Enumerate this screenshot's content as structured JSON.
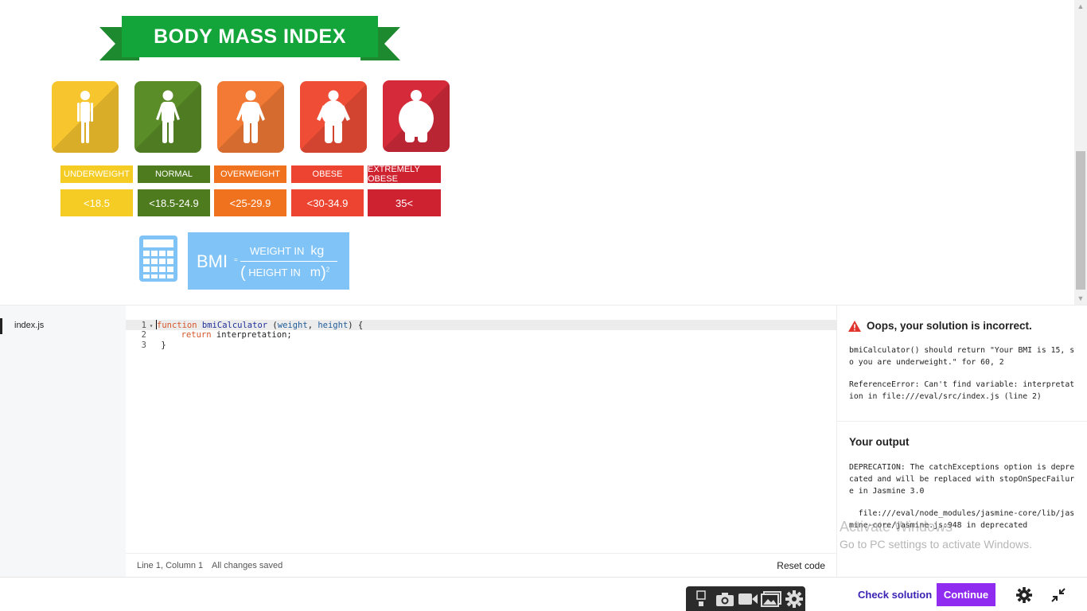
{
  "infographic": {
    "title": "BODY MASS INDEX",
    "categories": [
      {
        "label": "UNDERWEIGHT",
        "range": "<18.5",
        "tile_color": "#f7c52e",
        "label_color": "#f5cc23",
        "value_color": "#f5cc23"
      },
      {
        "label": "NORMAL",
        "range": "<18.5-24.9",
        "tile_color": "#5a8c28",
        "label_color": "#4e7b1e",
        "value_color": "#4e7b1e"
      },
      {
        "label": "OVERWEIGHT",
        "range": "<25-29.9",
        "tile_color": "#f27a34",
        "label_color": "#f0721f",
        "value_color": "#f0721f"
      },
      {
        "label": "OBESE",
        "range": "<30-34.9",
        "tile_color": "#ef4d36",
        "label_color": "#ec4430",
        "value_color": "#ec4430"
      },
      {
        "label": "EXTREMELY OBESE",
        "range": "35<",
        "tile_color": "#d42a3a",
        "label_color": "#cf2231",
        "value_color": "#cf2231"
      }
    ],
    "formula": {
      "bmi": "BMI",
      "equals": "=",
      "numerator": "WEIGHT IN",
      "numerator_unit": "kg",
      "open_paren": "(",
      "denominator": "HEIGHT IN",
      "denominator_unit": "m",
      "close_paren": ")",
      "exponent": "2"
    }
  },
  "files": [
    {
      "name": "index.js",
      "active": true
    }
  ],
  "editor": {
    "lines": [
      {
        "number": "1",
        "indent": "",
        "keyword": "function",
        "name": "bmiCalculator",
        "open": " (",
        "param1": "weight",
        "comma": ", ",
        "param2": "height",
        "close": ") {"
      },
      {
        "number": "2",
        "indent": "    ",
        "keyword": "return",
        "rest": " interpretation;"
      },
      {
        "number": "3",
        "text": "}"
      }
    ],
    "status_position": "Line 1, Column 1",
    "status_saved": "All changes saved",
    "reset_label": "Reset code"
  },
  "result": {
    "error_title": "Oops, your solution is incorrect.",
    "error_message": "bmiCalculator() should return \"Your BMI is 15, so you are underweight.\" for 60, 2",
    "reference_error": "ReferenceError: Can't find variable: interpretation in file:///eval/src/index.js (line 2)",
    "output_title": "Your output",
    "output_text_1": "DEPRECATION: The catchExceptions option is deprecated and will be replaced with stopOnSpecFailure in Jasmine 3.0",
    "output_text_2": "  file:///eval/node_modules/jasmine-core/lib/jasmine-core/jasmine.js:948 in deprecated"
  },
  "watermark": {
    "line1": "Activate Windows",
    "line2": "Go to PC settings to activate Windows."
  },
  "actions": {
    "check_solution": "Check solution",
    "continue": "Continue"
  },
  "colors": {
    "accent_purple": "#8f2cf0",
    "link_blue": "#3a23b5",
    "error_red": "#e0342c",
    "formula_blue": "#7fc3f7"
  }
}
